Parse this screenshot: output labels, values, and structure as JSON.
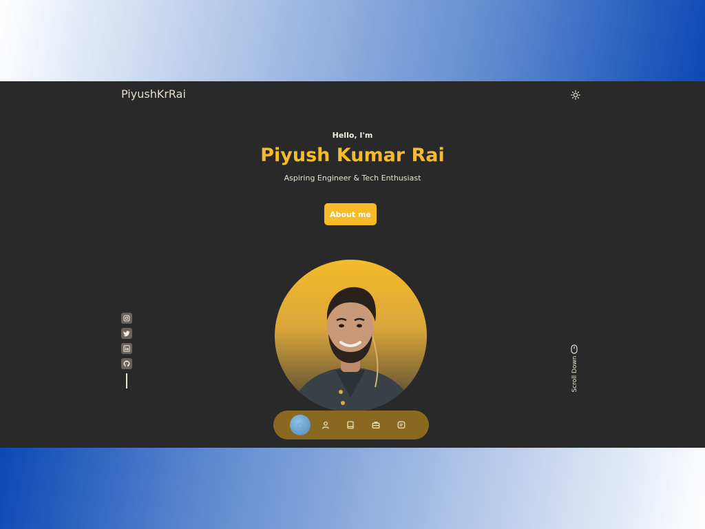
{
  "header": {
    "brand": "PiyushKrRai",
    "theme_icon": "sun-icon"
  },
  "hero": {
    "greeting": "Hello, I'm",
    "name": "Piyush Kumar Rai",
    "subtitle": "Aspiring Engineer & Tech Enthusiast",
    "cta_label": "About me"
  },
  "socials": [
    {
      "name": "instagram-icon"
    },
    {
      "name": "twitter-icon"
    },
    {
      "name": "linkedin-icon"
    },
    {
      "name": "github-icon"
    }
  ],
  "scroll": {
    "label": "Scroll Down",
    "icon": "mouse-icon"
  },
  "nav": {
    "items": [
      {
        "icon": "home-icon",
        "active": true
      },
      {
        "icon": "user-icon",
        "active": false
      },
      {
        "icon": "book-icon",
        "active": false
      },
      {
        "icon": "briefcase-icon",
        "active": false
      },
      {
        "icon": "message-icon",
        "active": false
      }
    ]
  },
  "colors": {
    "accent": "#f5bb2a",
    "background": "#292929",
    "nav_background": "#8a6820"
  }
}
